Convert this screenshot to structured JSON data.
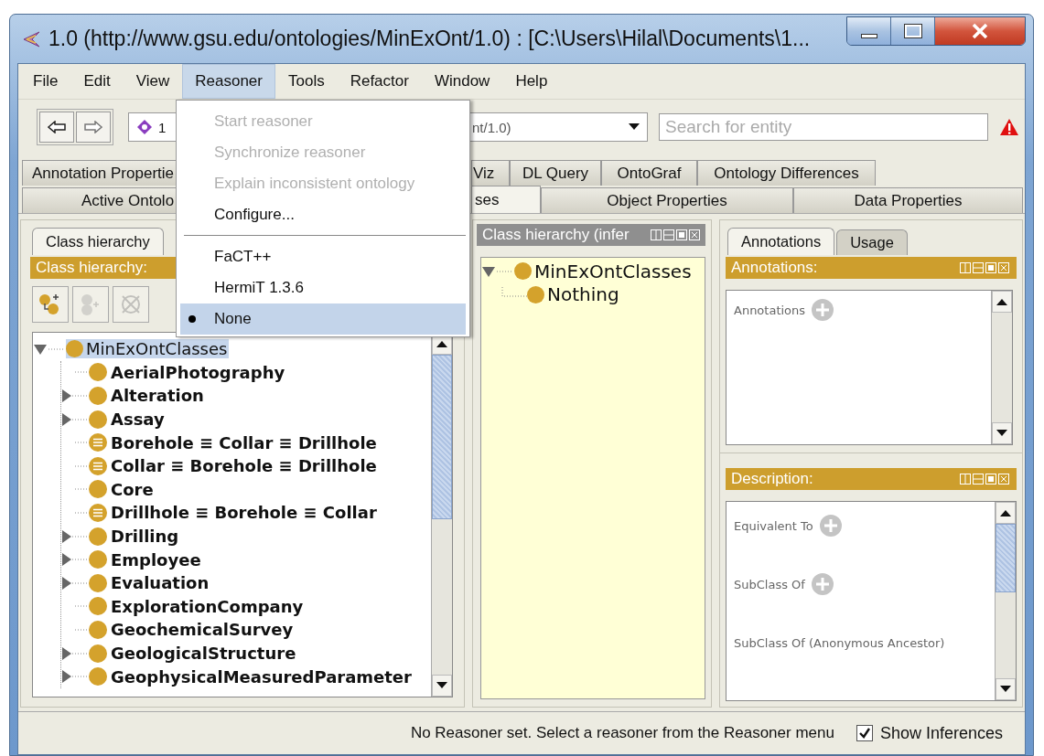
{
  "window": {
    "title": "1.0 (http://www.gsu.edu/ontologies/MinExOnt/1.0)  : [C:\\Users\\Hilal\\Documents\\1..."
  },
  "menu_bar": [
    {
      "label": "File",
      "selected": false
    },
    {
      "label": "Edit",
      "selected": false
    },
    {
      "label": "View",
      "selected": false
    },
    {
      "label": "Reasoner",
      "selected": true
    },
    {
      "label": "Tools",
      "selected": false
    },
    {
      "label": "Refactor",
      "selected": false
    },
    {
      "label": "Window",
      "selected": false
    },
    {
      "label": "Help",
      "selected": false
    }
  ],
  "reasoner_menu": {
    "items": [
      {
        "kind": "command",
        "label": "Start reasoner",
        "disabled": true
      },
      {
        "kind": "command",
        "label": "Synchronize reasoner",
        "disabled": true
      },
      {
        "kind": "command",
        "label": "Explain inconsistent ontology",
        "disabled": true
      },
      {
        "kind": "command",
        "label": "Configure...",
        "disabled": false
      },
      {
        "kind": "separator"
      },
      {
        "kind": "radio",
        "label": "FaCT++",
        "selected": false
      },
      {
        "kind": "radio",
        "label": "HermiT 1.3.6",
        "selected": false
      },
      {
        "kind": "radio",
        "label": "None",
        "selected": true
      }
    ]
  },
  "toolbar": {
    "ontology_combo": {
      "text_start": "1",
      "text_end": "nt/1.0)"
    },
    "search": {
      "placeholder": "Search for entity"
    }
  },
  "tabs_row_1": [
    {
      "label": "Annotation Propertie",
      "selected": false
    },
    {
      "label": "Viz",
      "selected": false
    },
    {
      "label": "DL Query",
      "selected": false
    },
    {
      "label": "OntoGraf",
      "selected": false
    },
    {
      "label": "Ontology Differences",
      "selected": false
    }
  ],
  "tabs_row_2": [
    {
      "label": "Active Ontolo",
      "selected": false
    },
    {
      "label": "ses",
      "selected": true
    },
    {
      "label": "Object Properties",
      "selected": false
    },
    {
      "label": "Data Properties",
      "selected": false
    }
  ],
  "left_panel": {
    "tabs": [
      {
        "label": "Class hierarchy",
        "selected": true
      }
    ],
    "header": "Class hierarchy:",
    "tools": [
      {
        "kind": "add_subclass",
        "disabled": false
      },
      {
        "kind": "add_sibling",
        "disabled": true
      },
      {
        "kind": "delete",
        "disabled": true
      }
    ],
    "tree": {
      "label": "MinExOntClasses",
      "selected": true,
      "children": [
        {
          "label": "AerialPhotography",
          "kind": "leaf",
          "equivalent": false
        },
        {
          "label": "Alteration",
          "kind": "collapsed",
          "equivalent": false
        },
        {
          "label": "Assay",
          "kind": "collapsed",
          "equivalent": false
        },
        {
          "label": "Borehole ≡ Collar ≡ Drillhole",
          "kind": "leaf",
          "equivalent": true
        },
        {
          "label": "Collar ≡ Borehole ≡ Drillhole",
          "kind": "leaf",
          "equivalent": true
        },
        {
          "label": "Core",
          "kind": "leaf",
          "equivalent": false
        },
        {
          "label": "Drillhole ≡ Borehole ≡ Collar",
          "kind": "leaf",
          "equivalent": true
        },
        {
          "label": "Drilling",
          "kind": "collapsed",
          "equivalent": false
        },
        {
          "label": "Employee",
          "kind": "collapsed",
          "equivalent": false
        },
        {
          "label": "Evaluation",
          "kind": "collapsed",
          "equivalent": false
        },
        {
          "label": "ExplorationCompany",
          "kind": "leaf",
          "equivalent": false
        },
        {
          "label": "GeochemicalSurvey",
          "kind": "leaf",
          "equivalent": false
        },
        {
          "label": "GeologicalStructure",
          "kind": "collapsed",
          "equivalent": false
        },
        {
          "label": "GeophysicalMeasuredParameter",
          "kind": "collapsed",
          "equivalent": false
        }
      ]
    }
  },
  "inferred_panel": {
    "header": "Class hierarchy (infer",
    "tree": {
      "label": "MinExOntClasses",
      "children": [
        {
          "label": "Nothing"
        }
      ]
    }
  },
  "right_panel": {
    "tabs": [
      {
        "label": "Annotations",
        "selected": true
      },
      {
        "label": "Usage",
        "selected": false
      }
    ],
    "annotations": {
      "header": "Annotations:",
      "sections": [
        {
          "label": "Annotations",
          "add_button": true
        }
      ]
    },
    "description": {
      "header": "Description:",
      "sections": [
        {
          "label": "Equivalent To",
          "add_button": true
        },
        {
          "label": "SubClass Of",
          "add_button": true
        },
        {
          "label": "SubClass Of (Anonymous Ancestor)",
          "add_button": false
        }
      ]
    }
  },
  "status_bar": {
    "message": "No Reasoner set. Select a reasoner from the Reasoner menu",
    "show_inferences": {
      "label": "Show Inferences",
      "checked": true
    }
  }
}
